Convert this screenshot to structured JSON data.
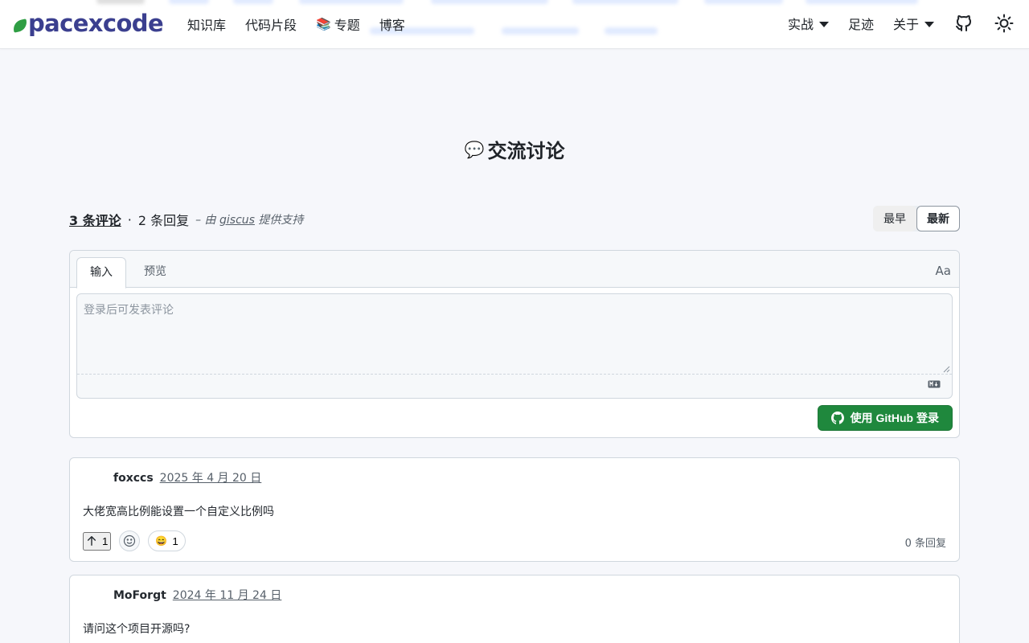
{
  "header": {
    "logo_text": "pacexcode",
    "nav": [
      {
        "label": "知识库"
      },
      {
        "label": "代码片段"
      },
      {
        "emoji": "📚",
        "label": "专题"
      },
      {
        "label": "博客"
      }
    ],
    "right": [
      {
        "label": "实战",
        "dropdown": true
      },
      {
        "label": "足迹"
      },
      {
        "label": "关于",
        "dropdown": true
      }
    ],
    "icons": [
      "github-icon",
      "sun-icon"
    ]
  },
  "section": {
    "emoji": "💬",
    "title": "交流讨论"
  },
  "discussion": {
    "comment_count": "3 条评论",
    "separator": "·",
    "reply_count": "2 条回复",
    "powered_prefix": "– 由",
    "powered_link": "giscus",
    "powered_suffix": "提供支持",
    "sort": {
      "oldest": "最早",
      "newest": "最新",
      "active": "newest"
    }
  },
  "editor": {
    "tab_write": "输入",
    "tab_preview": "预览",
    "font_toggle": "Aa",
    "placeholder": "登录后可发表评论",
    "login_button": "使用 GitHub 登录"
  },
  "comments": [
    {
      "author": "foxccs",
      "date": "2025 年 4 月 20 日",
      "body": "大佬宽高比例能设置一个自定义比例吗",
      "upvotes": "1",
      "reaction_emoji": "😄",
      "reaction_count": "1",
      "replies": "0 条回复"
    },
    {
      "author": "MoForgt",
      "date": "2024 年 11 月 24 日",
      "body": "请问这个项目开源吗?"
    }
  ],
  "colors": {
    "brand": "#3b3f8f",
    "primary_button": "#1f883d",
    "background": "#f6f7fb"
  }
}
